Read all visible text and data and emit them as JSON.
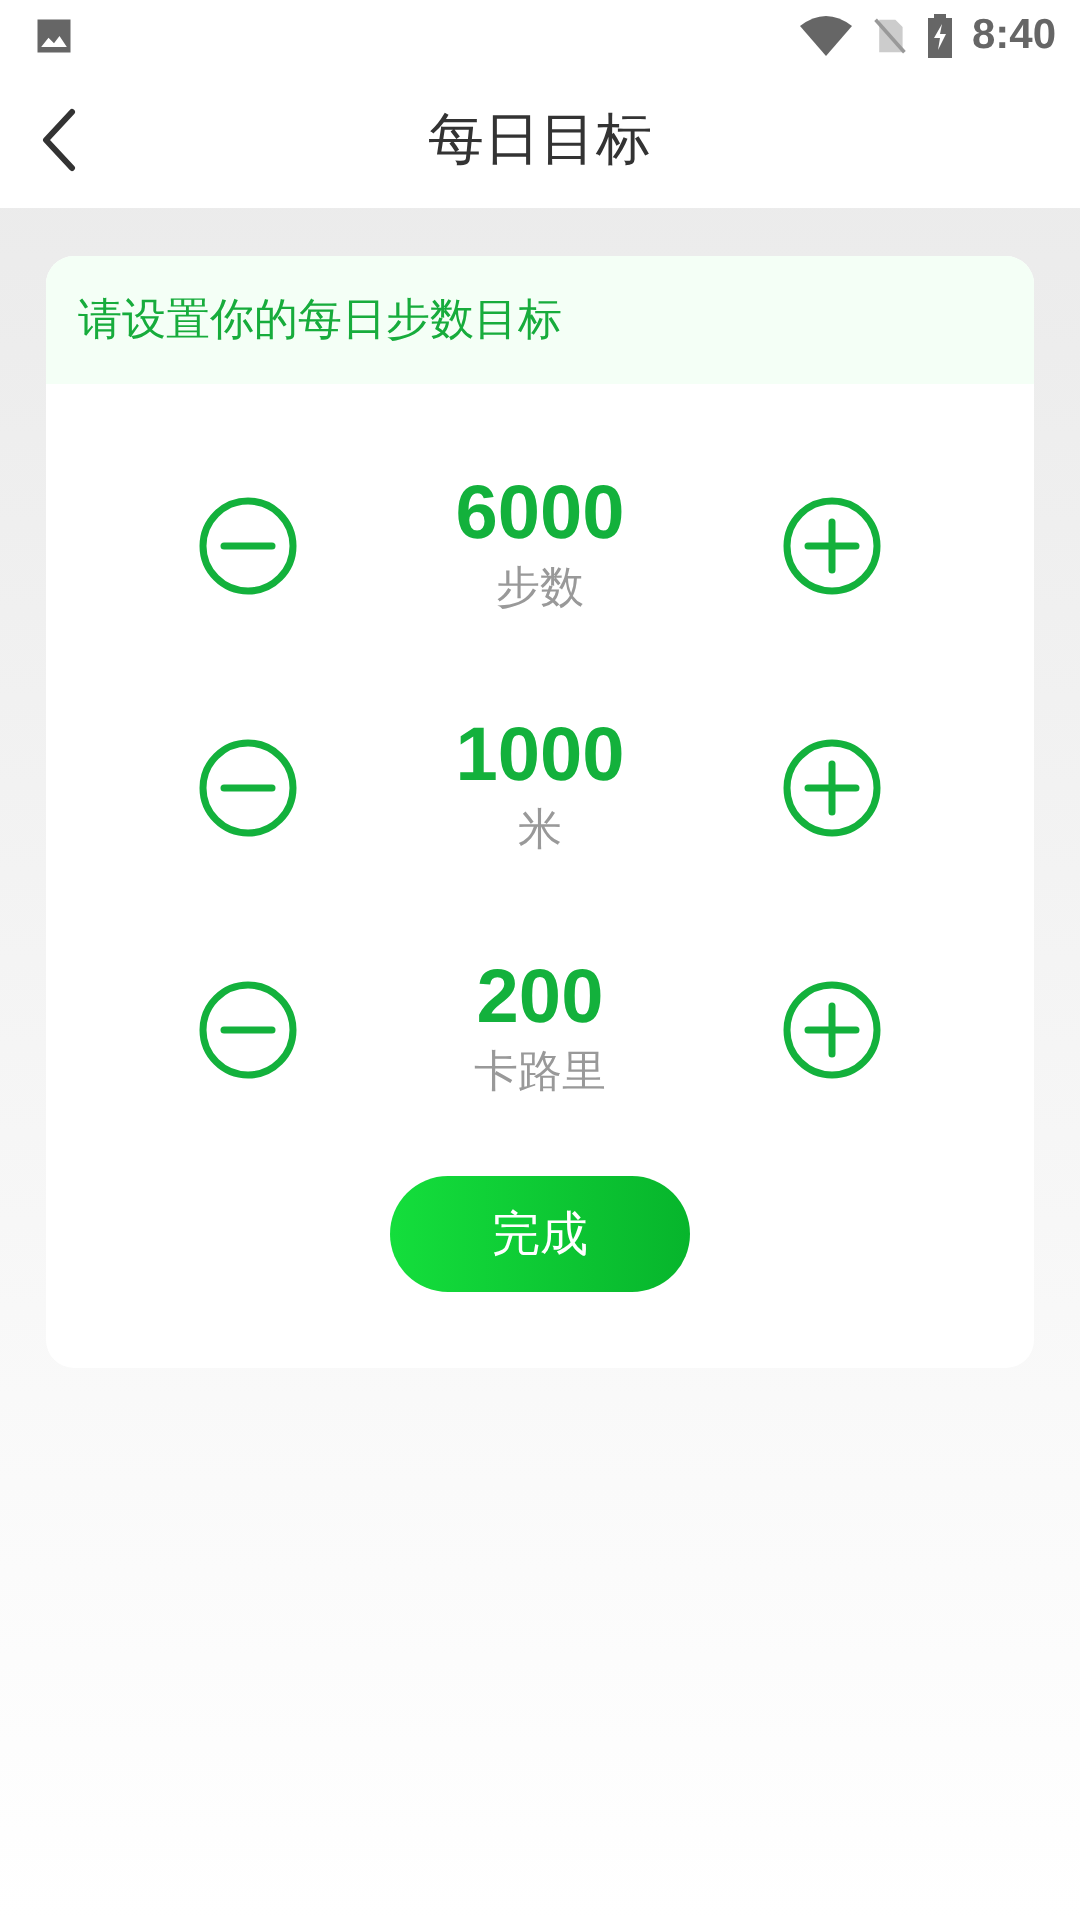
{
  "status_bar": {
    "time": "8:40"
  },
  "header": {
    "title": "每日目标"
  },
  "card": {
    "prompt": "请设置你的每日步数目标",
    "goals": [
      {
        "value": "6000",
        "unit": "步数"
      },
      {
        "value": "1000",
        "unit": "米"
      },
      {
        "value": "200",
        "unit": "卡路里"
      }
    ],
    "done_button": "完成"
  }
}
